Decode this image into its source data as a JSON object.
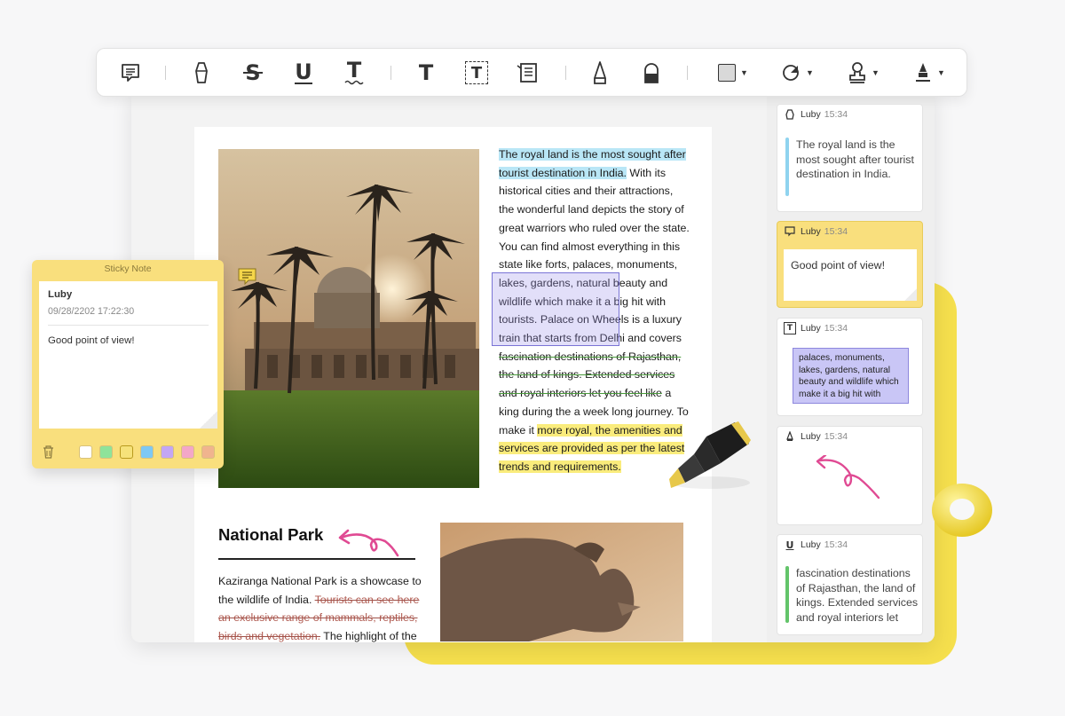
{
  "toolbar": {
    "items": [
      {
        "name": "comment-icon"
      },
      {
        "name": "highlight-icon"
      },
      {
        "name": "strikethrough-icon",
        "glyph": "S"
      },
      {
        "name": "underline-icon",
        "glyph": "U"
      },
      {
        "name": "squiggly-icon",
        "glyph": "T"
      },
      {
        "name": "text-icon",
        "glyph": "T"
      },
      {
        "name": "textbox-icon",
        "glyph": "T"
      },
      {
        "name": "callout-icon"
      },
      {
        "name": "pencil-icon"
      },
      {
        "name": "eraser-icon"
      },
      {
        "name": "shape-icon"
      },
      {
        "name": "area-highlight-icon"
      },
      {
        "name": "stamp-icon"
      },
      {
        "name": "signature-icon"
      }
    ]
  },
  "article": {
    "para1_hl_blue": "The royal land is the most sought after tourist destination in India.",
    "para1_a": " With its historical cities and their attractions, the wonderful land depicts the story of great warriors who ruled over the state. You can find almost everything in this state like forts, palaces, monuments, lakes, gardens, natural beauty and wildlife which make it a big hit with tourists. Palace on Wheels is a luxury train that starts from Delhi and covers ",
    "para1_strike": "fascination destinations of Rajasthan, the land of kings. Extended services and royal interiors let you feel like",
    "para1_b": " a king during the a week long journey. To make it ",
    "para1_hl_yellow": "more royal, the amenities and services are provided as per the latest trends and requirements.",
    "national_park_title": "National Park",
    "np_a": "Kaziranga National Park is a showcase to the wildlife of India. ",
    "np_strike": "Tourists can see here an exclusive range of mammals, reptiles, birds and vegetation.",
    "np_b": " The highlight of the"
  },
  "comments": [
    {
      "author": "Luby",
      "time": "15:34",
      "icon": "highlight-icon",
      "text": "The royal land is the most sought after tourist destination in India.",
      "bar_color": "#8fd3ef"
    },
    {
      "author": "Luby",
      "time": "15:34",
      "icon": "comment-icon",
      "text": "Good point of view!"
    },
    {
      "author": "Luby",
      "time": "15:34",
      "icon": "textbox-icon",
      "text": "palaces, monuments, lakes, gardens, natural beauty and wildlife which make it a big hit with"
    },
    {
      "author": "Luby",
      "time": "15:34",
      "icon": "pencil-icon"
    },
    {
      "author": "Luby",
      "time": "15:34",
      "icon": "underline-icon",
      "glyph": "U",
      "text": "fascination destinations of Rajasthan, the land of kings. Extended services and royal interiors let",
      "bar_color": "#63c46a"
    }
  ],
  "sticky_note": {
    "title": "Sticky Note",
    "author": "Luby",
    "date": "09/28/2202 17:22:30",
    "text": "Good point of view!",
    "swatch_colors": [
      "#ffffff",
      "#8fe39a",
      "#f6e27a",
      "#7ec8f4",
      "#c3a6f4",
      "#f3a7c8",
      "#f0b48e"
    ]
  },
  "colors": {
    "accent_yellow": "#f5df4d",
    "ink_pink": "#e04a93",
    "highlight_blue": "#b9e6f6",
    "highlight_yellow": "#faec7c",
    "area_purple": "#7a74d6"
  }
}
